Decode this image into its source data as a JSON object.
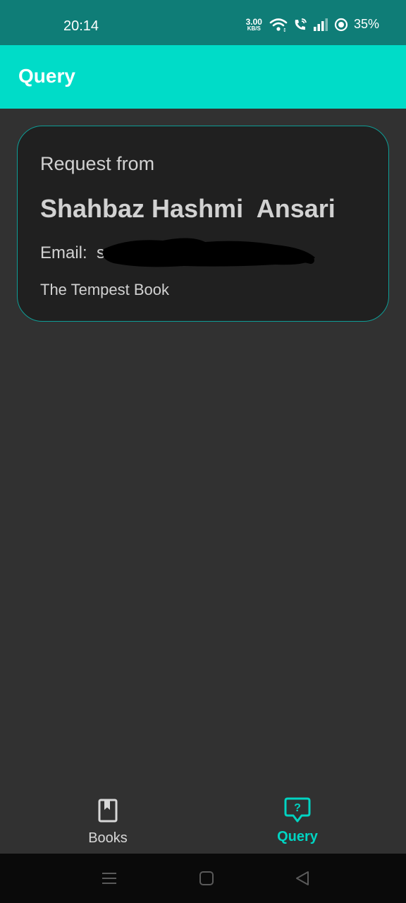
{
  "status_bar": {
    "time": "20:14",
    "net_speed_value": "3.00",
    "net_speed_unit": "KB/S",
    "battery": "35%",
    "icons": [
      "wifi-icon",
      "wifi-call-icon",
      "signal-icon",
      "battery-ring-icon"
    ]
  },
  "app_bar": {
    "title": "Query"
  },
  "request_card": {
    "heading": "Request from",
    "name": "Shahbaz Hashmi  Ansari",
    "email_label": "Email:",
    "email_visible": "s                              ail.com",
    "book": "The Tempest Book"
  },
  "bottom_nav": {
    "items": [
      {
        "label": "Books",
        "icon": "bookmark-book-icon",
        "active": false
      },
      {
        "label": "Query",
        "icon": "question-bubble-icon",
        "active": true
      }
    ]
  },
  "colors": {
    "status_bar": "#0f7d77",
    "app_bar": "#00dcc8",
    "background": "#313131",
    "card": "#202020",
    "card_border": "#0e9d96",
    "accent": "#00d4c2"
  }
}
